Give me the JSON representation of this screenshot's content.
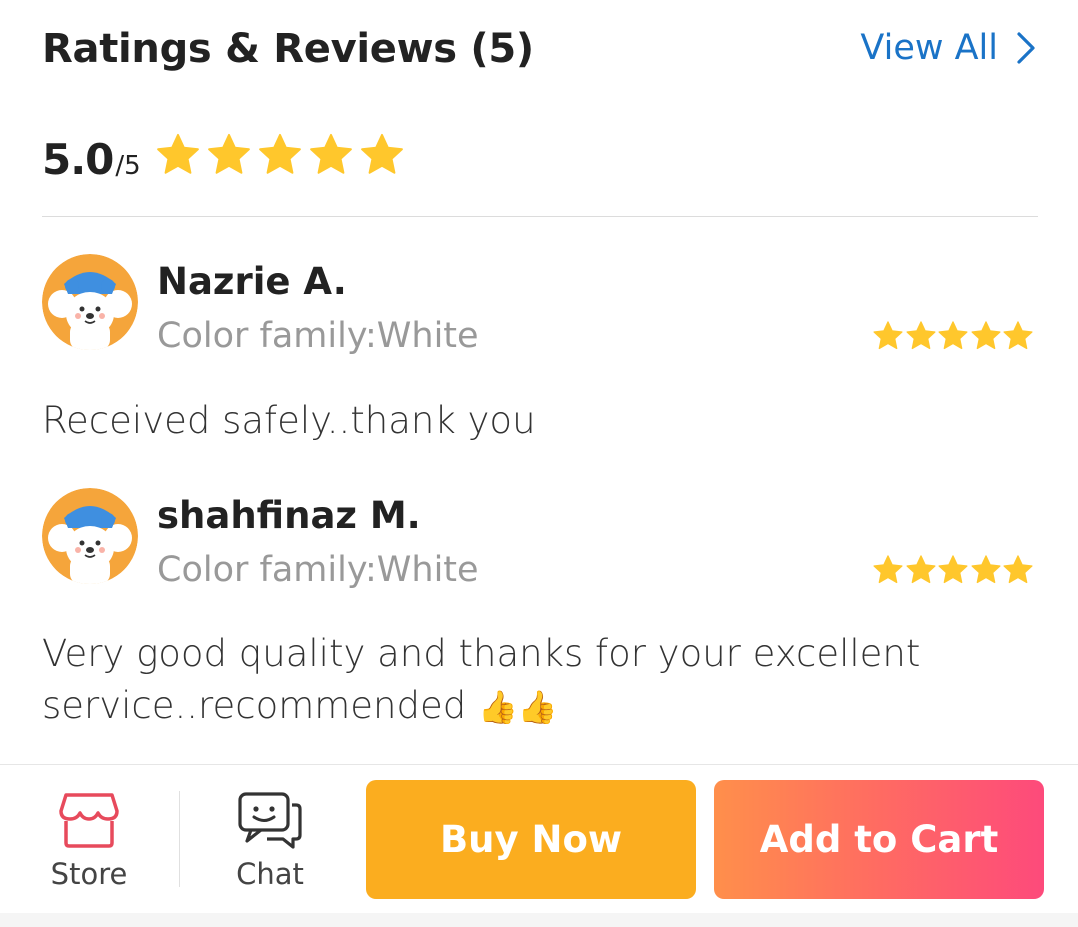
{
  "header": {
    "title": "Ratings & Reviews (5)",
    "view_all_label": "View All"
  },
  "summary": {
    "score": "5.0",
    "score_max": "/5",
    "stars": 5
  },
  "colors": {
    "star": "#ffc72c",
    "link": "#1a73c7",
    "buy_now": "#fbad1f",
    "add_to_cart_start": "#ff8f4b",
    "add_to_cart_end": "#fd4a7b",
    "store_icon": "#e74a5c"
  },
  "reviews": [
    {
      "name": "Nazrie A.",
      "variant": "Color family:White",
      "rating": 5,
      "text": "Received safely..thank you"
    },
    {
      "name": "shahfinaz M.",
      "variant": "Color family:White",
      "rating": 5,
      "text_line1": "Very good quality and thanks for your excellent",
      "text_line2": "service..recommended",
      "emoji": "👍👍"
    }
  ],
  "bottom_bar": {
    "store_label": "Store",
    "chat_label": "Chat",
    "buy_now_label": "Buy Now",
    "add_to_cart_label": "Add to Cart"
  },
  "icons": [
    "chevron-right-icon",
    "star-icon",
    "bear-avatar-icon",
    "store-icon",
    "chat-icon",
    "thumbs-up-icon"
  ]
}
